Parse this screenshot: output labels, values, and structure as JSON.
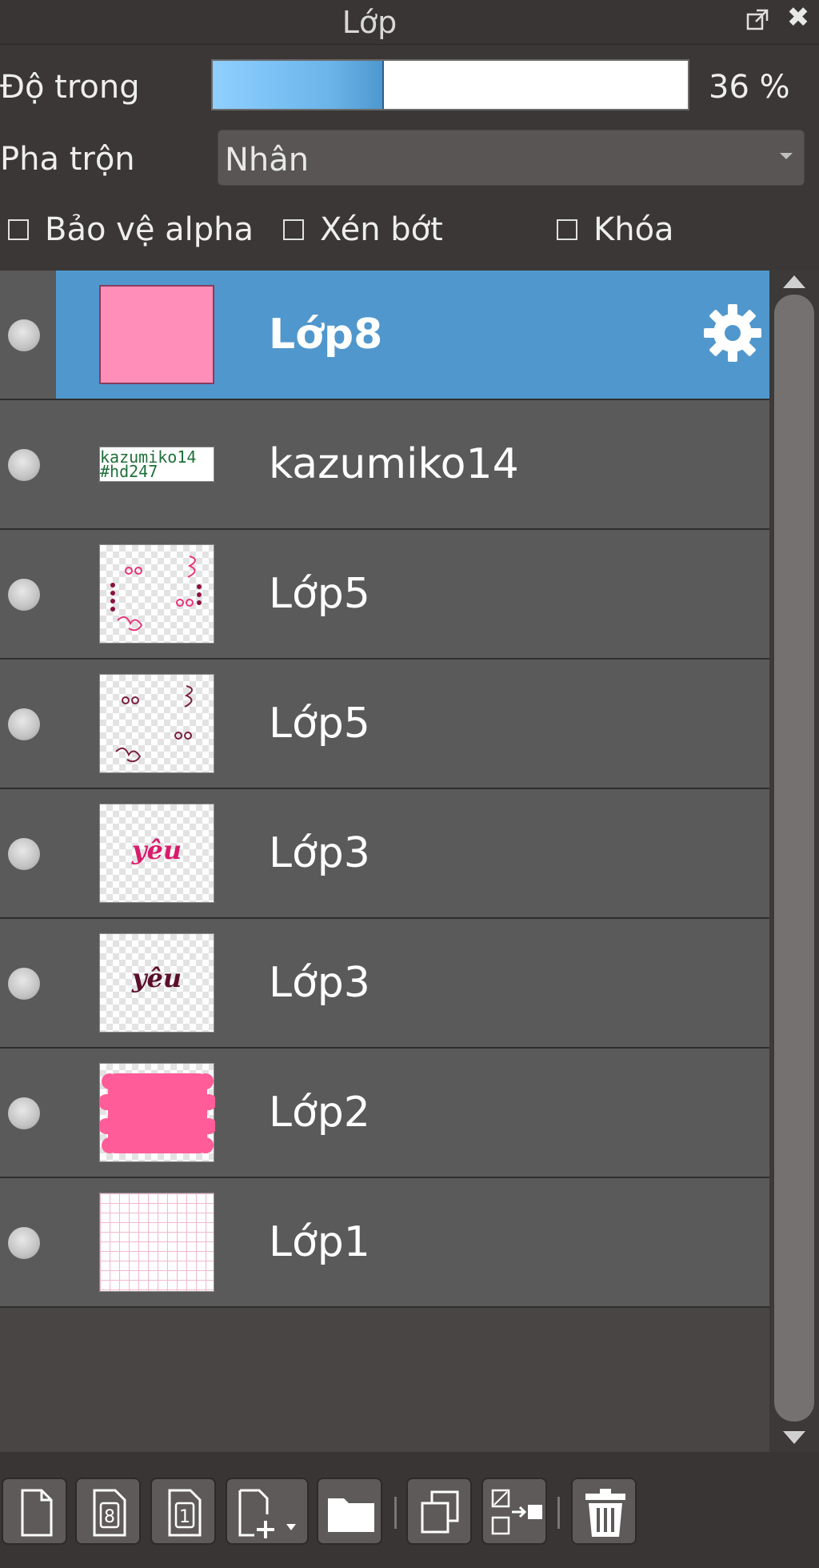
{
  "panel": {
    "title": "Lớp"
  },
  "opacity": {
    "label": "Độ trong",
    "value_text": "36 %",
    "fraction": 0.36
  },
  "blend": {
    "label": "Pha trộn",
    "value": "Nhân"
  },
  "options": {
    "alpha_protect": {
      "label": "Bảo vệ alpha",
      "checked": false
    },
    "clipping": {
      "label": "Xén bớt",
      "checked": false
    },
    "lock": {
      "label": "Khóa",
      "checked": false
    }
  },
  "layers": [
    {
      "name": "Lớp8",
      "selected": true,
      "thumbnail": "solid-pink"
    },
    {
      "name": "kazumiko14",
      "thumbnail_text": [
        "kazumiko14",
        "#hd247"
      ]
    },
    {
      "name": "Lớp5",
      "thumbnail": "pink-doodles"
    },
    {
      "name": "Lớp5",
      "thumbnail": "dark-doodles"
    },
    {
      "name": "Lớp3",
      "thumbnail_text": [
        "yêu"
      ],
      "thumb_color": "#d81b6b"
    },
    {
      "name": "Lớp3",
      "thumbnail_text": [
        "yêu"
      ],
      "thumb_color": "#5a0f2a"
    },
    {
      "name": "Lớp2",
      "thumbnail": "pink-banner"
    },
    {
      "name": "Lớp1",
      "thumbnail": "pink-grid"
    }
  ],
  "colors": {
    "selected_row": "#4f97cc",
    "row": "#5a5a5a",
    "opacity_fill": "#6ab4ea",
    "pink": "#ff8fb9"
  },
  "toolbar": {
    "buttons": [
      "new-layer",
      "new-layer-8bit",
      "new-layer-1bit",
      "add-layer-menu",
      "new-folder",
      "duplicate-layer",
      "merge-down",
      "delete-layer"
    ]
  }
}
